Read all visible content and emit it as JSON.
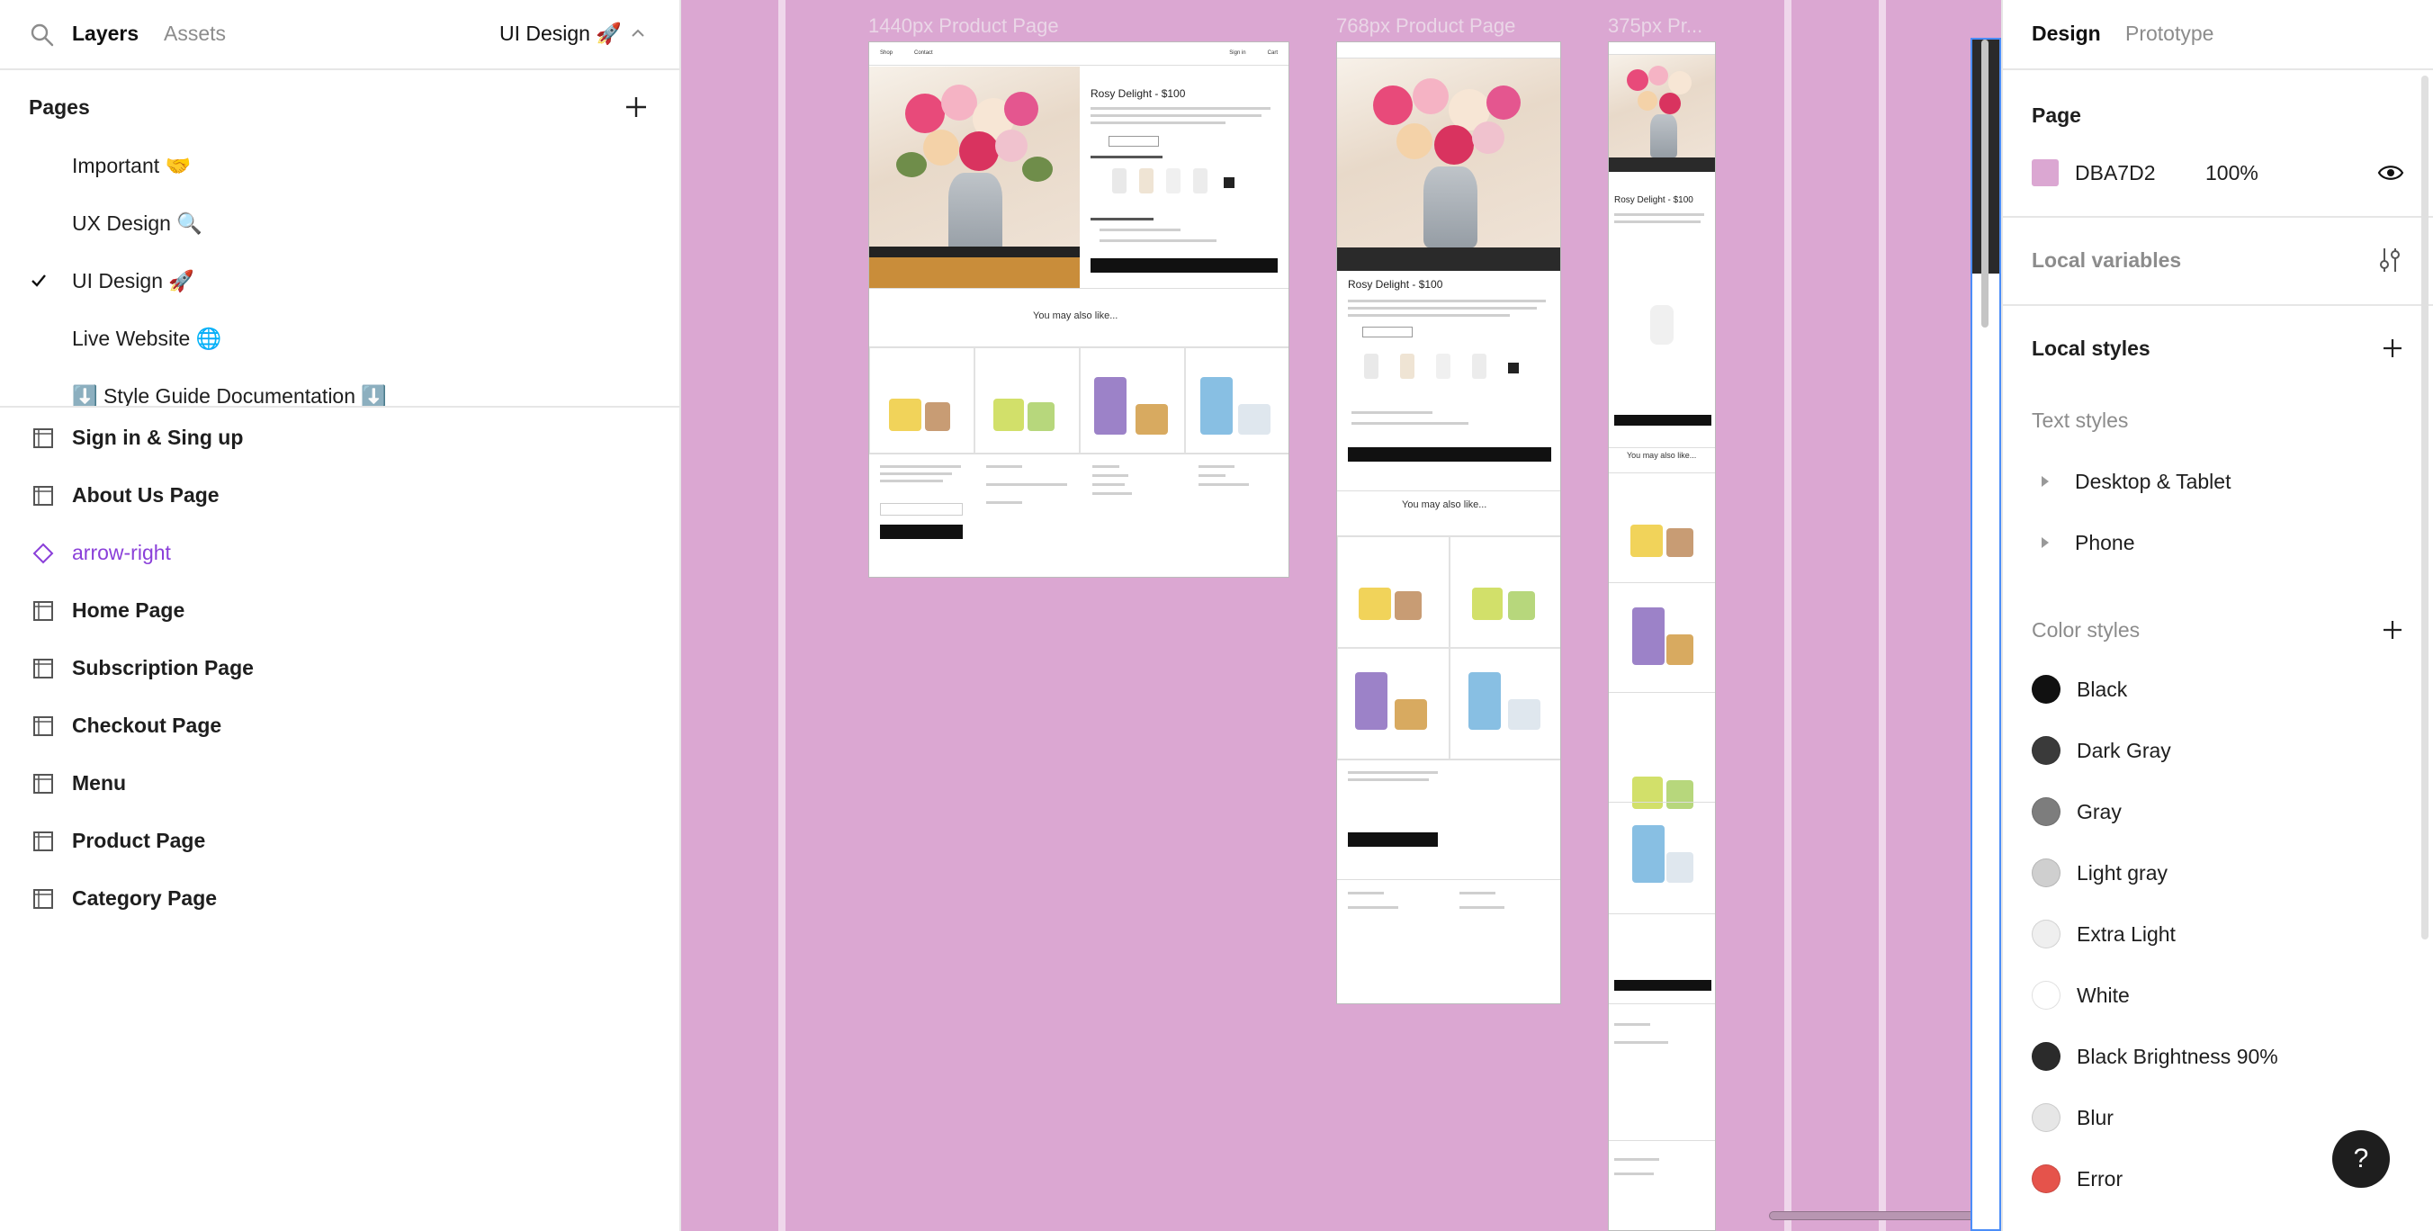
{
  "left_panel": {
    "tabs": {
      "layers": "Layers",
      "assets": "Assets"
    },
    "current_page": "UI Design 🚀",
    "pages_title": "Pages",
    "pages": [
      {
        "label": "Important 🤝",
        "current": false
      },
      {
        "label": "UX Design  🔍",
        "current": false
      },
      {
        "label": "UI Design 🚀",
        "current": true
      },
      {
        "label": "Live Website 🌐",
        "current": false
      },
      {
        "label": "⬇️ Style Guide Documentation ⬇️",
        "current": false
      }
    ],
    "layers": [
      {
        "label": "Sign in & Sing up",
        "type": "frame"
      },
      {
        "label": "About Us Page",
        "type": "frame"
      },
      {
        "label": "arrow-right",
        "type": "component"
      },
      {
        "label": "Home Page",
        "type": "frame"
      },
      {
        "label": "Subscription Page",
        "type": "frame"
      },
      {
        "label": "Checkout Page",
        "type": "frame"
      },
      {
        "label": "Menu",
        "type": "frame"
      },
      {
        "label": "Product Page",
        "type": "frame"
      },
      {
        "label": "Category Page",
        "type": "frame"
      }
    ]
  },
  "canvas": {
    "background": "#DBA7D2",
    "frames": [
      {
        "label": "1440px Product Page",
        "nav": [
          "Shop",
          "Contact",
          "Sign in",
          "Cart"
        ],
        "product_title": "Rosy Delight - $100",
        "you_may_also_like": "You may also like..."
      },
      {
        "label": "768px Product Page",
        "product_title": "Rosy Delight - $100",
        "you_may_also_like": "You may also like..."
      },
      {
        "label": "375px Pr...",
        "product_title": "Rosy Delight - $100",
        "you_may_also_like": "You may also like..."
      }
    ]
  },
  "right_panel": {
    "tabs": {
      "design": "Design",
      "prototype": "Prototype"
    },
    "page_section": {
      "title": "Page",
      "color_hex": "DBA7D2",
      "color_value": "#DBA7D2",
      "opacity": "100%"
    },
    "local_variables": "Local variables",
    "local_styles": "Local styles",
    "text_styles": {
      "title": "Text styles",
      "groups": [
        "Desktop & Tablet",
        "Phone"
      ]
    },
    "color_styles": {
      "title": "Color styles",
      "items": [
        {
          "label": "Black",
          "color": "#111111"
        },
        {
          "label": "Dark Gray",
          "color": "#3a3a3a"
        },
        {
          "label": "Gray",
          "color": "#7d7d7d"
        },
        {
          "label": "Light gray",
          "color": "#cfcfcf"
        },
        {
          "label": "Extra Light",
          "color": "#efefef"
        },
        {
          "label": "White",
          "color": "#ffffff"
        },
        {
          "label": "Black Brightness 90%",
          "color": "#2b2b2b"
        },
        {
          "label": "Blur",
          "color": "#e6e6e6"
        },
        {
          "label": "Error",
          "color": "#e5534b"
        }
      ]
    },
    "help_label": "?"
  }
}
